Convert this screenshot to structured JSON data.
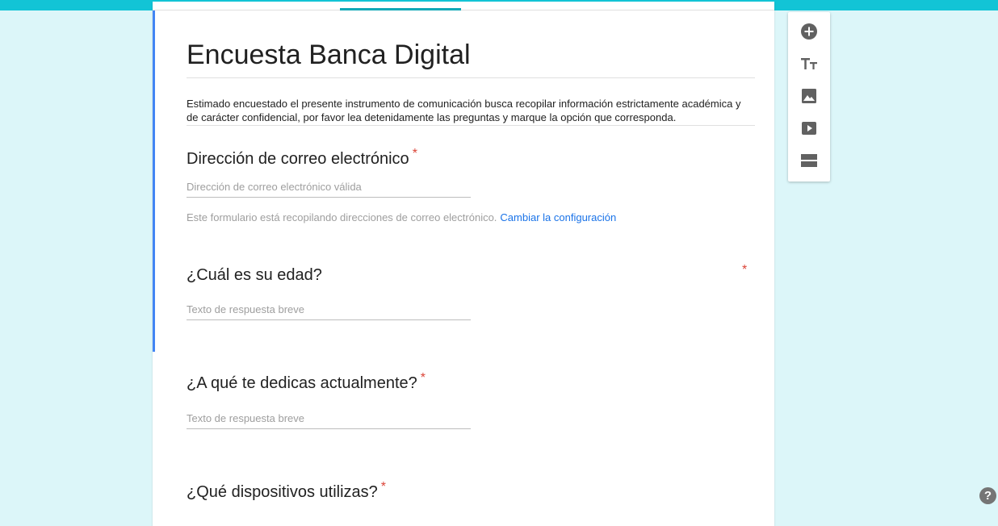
{
  "form": {
    "title": "Encuesta Banca Digital",
    "description": "Estimado encuestado el presente instrumento de comunicación busca recopilar información estrictamente académica y de carácter confidencial, por favor lea detenidamente las preguntas y marque la opción que corresponda.",
    "required_mark": "*"
  },
  "questions": [
    {
      "title": "Dirección de correo electrónico",
      "placeholder": "Dirección de correo electrónico válida"
    },
    {
      "title": "¿Cuál es su edad?",
      "placeholder": "Texto de respuesta breve"
    },
    {
      "title": "¿A qué te dedicas actualmente?",
      "placeholder": "Texto de respuesta breve"
    },
    {
      "title": "¿Qué dispositivos utilizas?"
    }
  ],
  "email_collection": {
    "note": "Este formulario está recopilando direcciones de correo electrónico.",
    "link": "Cambiar la configuración"
  },
  "toolbar": {
    "items": [
      "add-question-icon",
      "add-title-icon",
      "add-image-icon",
      "add-video-icon",
      "add-section-icon"
    ]
  },
  "help": {
    "label": "?"
  },
  "colors": {
    "accent": "#12c4d6",
    "background": "#dcf6f9",
    "selected_bar": "#4285f4",
    "required": "#db4437",
    "link": "#1a73e8"
  }
}
